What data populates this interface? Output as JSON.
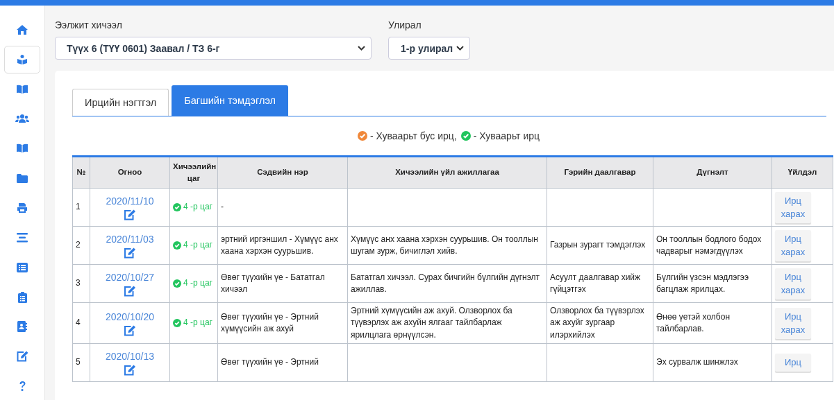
{
  "sidebar": {
    "items": [
      {
        "selected": false
      },
      {
        "selected": true
      },
      {
        "selected": false
      },
      {
        "selected": false
      },
      {
        "selected": false
      },
      {
        "selected": false
      },
      {
        "selected": false
      },
      {
        "selected": false
      },
      {
        "selected": false
      },
      {
        "selected": false
      },
      {
        "selected": false
      },
      {
        "selected": false
      },
      {
        "selected": false
      }
    ]
  },
  "filters": [
    {
      "label": "Ээлжит хичээл",
      "value": "Түүх 6 (ТҮҮ 0601) Заавал / ТЗ 6-г",
      "kind": "wide"
    },
    {
      "label": "Улирал",
      "value": "1-р улирал",
      "kind": "narrow"
    }
  ],
  "tabs": [
    {
      "label": "Ирцийн нэгтгэл",
      "selected": false
    },
    {
      "label": "Багшийн тэмдэглэл",
      "selected": true
    }
  ],
  "legend": [
    {
      "text": "- Хуваарьт бус ирц,",
      "color": "#f0883a"
    },
    {
      "text": "- Хуваарьт ирц",
      "color": "#22c55e"
    }
  ],
  "table": {
    "columns": [
      "№",
      "Огноо",
      "Хичээлийн цаг",
      "Сэдвийн нэр",
      "Хичээлийн үйл ажиллагаа",
      "Гэрийн даалгавар",
      "Дүгнэлт",
      "Үйлдэл"
    ],
    "rows": [
      {
        "no": "1",
        "date": "2020/11/10",
        "time": "4 -р цаг",
        "scheduled": true,
        "topic": "-",
        "activity": "",
        "homework": "",
        "evaluation": "",
        "action": "Ирц харах"
      },
      {
        "no": "2",
        "date": "2020/11/03",
        "time": "4 -р цаг",
        "scheduled": true,
        "topic": "эртний иргэншил - Хүмүүс анх хаана хэрхэн суурьшив.",
        "activity": "Хүмүүс анх хаана хэрхэн суурьшив. Он тооллын шугам зурж, бичиглэл хийв.",
        "homework": "Газрын зурагт тэмдэглэх",
        "evaluation": "Он тооллын бодлого бодох чадварыг нэмэгдүүлэх",
        "action": "Ирц харах"
      },
      {
        "no": "3",
        "date": "2020/10/27",
        "time": "4 -р цаг",
        "scheduled": true,
        "topic": "Өвөг түүхийн үе - Бататгал хичээл",
        "activity": "Бататгал хичээл. Сурах бичгийн бүлгийн дүгнэлт ажиллав.",
        "homework": "Асуулт даалгавар хийж гүйцэтгэх",
        "evaluation": "Бүлгийн үзсэн мэдлэгээ багцлаж ярилцах.",
        "action": "Ирц харах"
      },
      {
        "no": "4",
        "date": "2020/10/20",
        "time": "4 -р цаг",
        "scheduled": true,
        "topic": "Өвөг түүхийн үе - Эртний хүмүүсийн аж ахуй",
        "activity": "Эртний хүмүүсийн аж ахуй. Олзворлох ба түүвэрлэх аж ахуйн ялгааг тайлбарлаж ярилцлага өрнүүлсэн.",
        "homework": "Олзворлох ба түүвэрлэх аж ахуйг зургаар илэрхийлэх",
        "evaluation": "Өнөө үетэй холбон тайлбарлав.",
        "action": "Ирц харах"
      },
      {
        "no": "5",
        "date": "2020/10/13",
        "topic": "Өвөг түүхийн үе - Эртний",
        "activity": "",
        "homework": "",
        "evaluation": "Эх сурвалж шинжлэх",
        "action": "Ирц"
      }
    ]
  }
}
